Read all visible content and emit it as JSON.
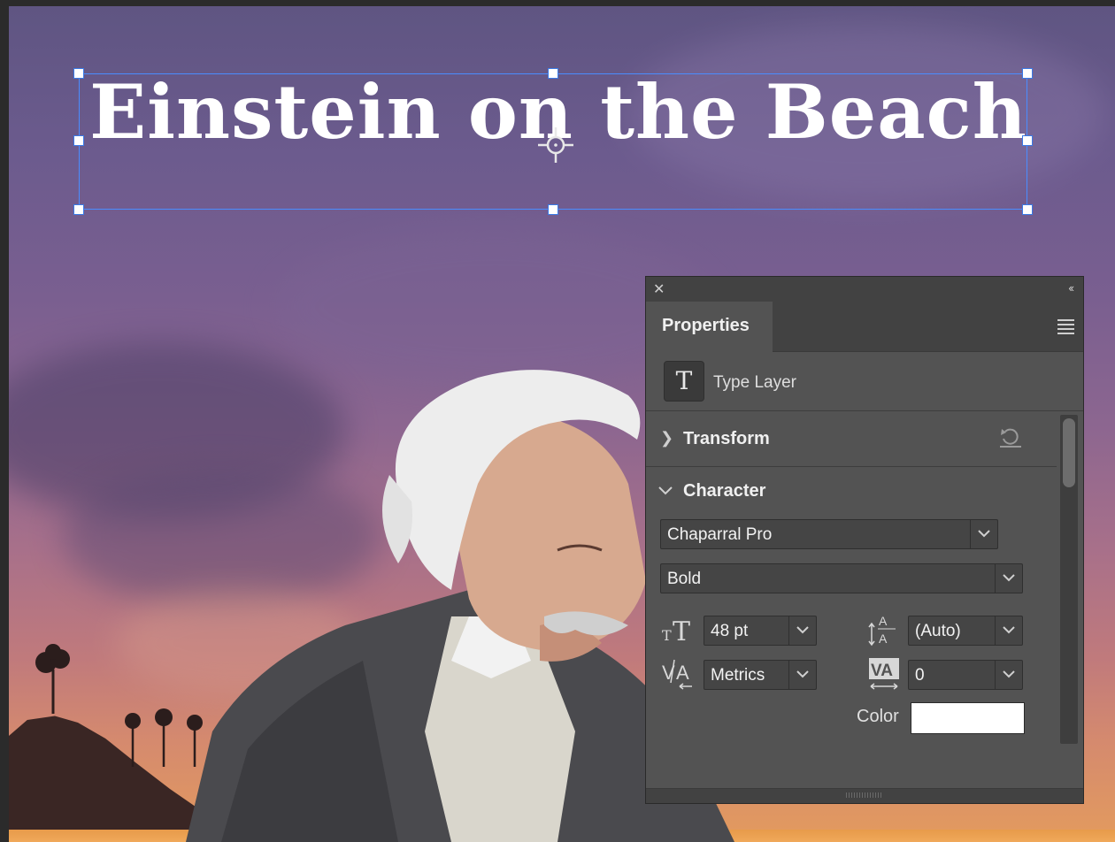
{
  "canvas": {
    "title_text": "Einstein on the Beach"
  },
  "panel": {
    "tab_label": "Properties",
    "layer_type": "Type Layer",
    "layer_icon_glyph": "T",
    "sections": {
      "transform": "Transform",
      "character": "Character"
    },
    "character": {
      "font_family": "Chaparral Pro",
      "font_style": "Bold",
      "font_size": "48 pt",
      "leading": "(Auto)",
      "kerning": "Metrics",
      "tracking": "0",
      "color_label": "Color",
      "color_value": "#ffffff"
    },
    "icons": [
      "close-icon",
      "collapse-icon",
      "panel-menu-icon",
      "type-layer-icon",
      "chevron-right-icon",
      "chevron-down-icon",
      "reset-icon",
      "font-size-icon",
      "leading-icon",
      "kerning-icon",
      "tracking-icon"
    ]
  },
  "colors": {
    "selection": "#4a8dff",
    "panel_bg": "#535353",
    "panel_header": "#424242"
  }
}
